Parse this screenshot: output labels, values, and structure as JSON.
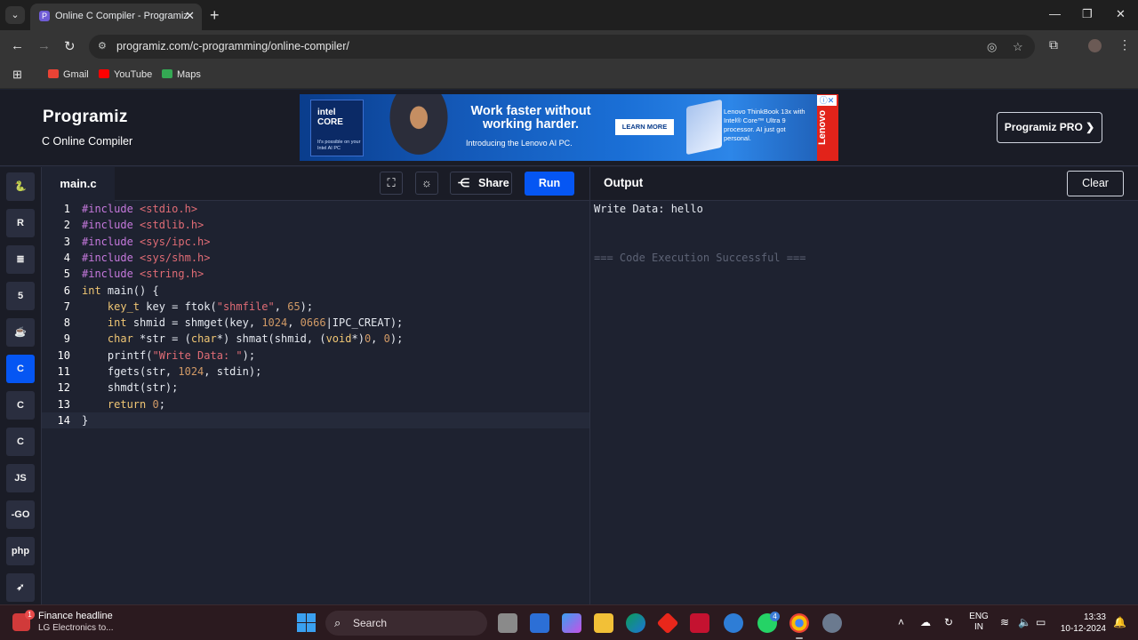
{
  "browser": {
    "tab_title": "Online C Compiler - Programiz",
    "url": "programiz.com/c-programming/online-compiler/",
    "bookmarks": [
      "Gmail",
      "YouTube",
      "Maps"
    ]
  },
  "header": {
    "logo": "Programiz",
    "subtitle": "C Online Compiler",
    "pro_button": "Programiz PRO ❯"
  },
  "ad": {
    "intel": "intel CORE",
    "intel_tag": "It's possible on your Intel AI PC",
    "headline": "Work faster without working harder.",
    "subline": "Introducing the Lenovo AI PC.",
    "cta": "LEARN MORE",
    "right_text": "Lenovo ThinkBook 13x with Intel® Core™ Ultra 9 processor. AI just got personal.",
    "brand": "Lenovo"
  },
  "sidebar": {
    "languages": [
      {
        "name": "python",
        "glyph": "🐍"
      },
      {
        "name": "r",
        "glyph": "R"
      },
      {
        "name": "sql",
        "glyph": "≣"
      },
      {
        "name": "html",
        "glyph": "5"
      },
      {
        "name": "java",
        "glyph": "☕"
      },
      {
        "name": "c",
        "glyph": "C",
        "active": true
      },
      {
        "name": "cpp",
        "glyph": "C"
      },
      {
        "name": "csharp",
        "glyph": "C"
      },
      {
        "name": "javascript",
        "glyph": "JS"
      },
      {
        "name": "go",
        "glyph": "-GO"
      },
      {
        "name": "php",
        "glyph": "php"
      },
      {
        "name": "swift",
        "glyph": "➶"
      }
    ]
  },
  "editor": {
    "file_tab": "main.c",
    "share_label": "Share",
    "run_label": "Run",
    "line_numbers": [
      "1",
      "2",
      "3",
      "4",
      "5",
      "6",
      "7",
      "8",
      "9",
      "10",
      "11",
      "12",
      "13",
      "14"
    ]
  },
  "code": [
    "#include <stdio.h>",
    "#include <stdlib.h>",
    "#include <sys/ipc.h>",
    "#include <sys/shm.h>",
    "#include <string.h>",
    "int main() {",
    "    key_t key = ftok(\"shmfile\", 65);",
    "    int shmid = shmget(key, 1024, 0666|IPC_CREAT);",
    "    char *str = (char*) shmat(shmid, (void*)0, 0);",
    "    printf(\"Write Data: \");",
    "    fgets(str, 1024, stdin);",
    "    shmdt(str);",
    "    return 0;",
    "}"
  ],
  "output": {
    "title": "Output",
    "clear_label": "Clear",
    "line1": "Write Data: hello",
    "status": "=== Code Execution Successful ==="
  },
  "taskbar": {
    "news_title": "Finance headline",
    "news_sub": "LG Electronics to...",
    "news_badge": "1",
    "search_placeholder": "Search",
    "whatsapp_badge": "4",
    "lang_line1": "ENG",
    "lang_line2": "IN",
    "time": "13:33",
    "date": "10-12-2024"
  },
  "colors": {
    "accent": "#0556f3",
    "editor_bg": "#1e2230",
    "header_bg": "#1a1c26"
  }
}
